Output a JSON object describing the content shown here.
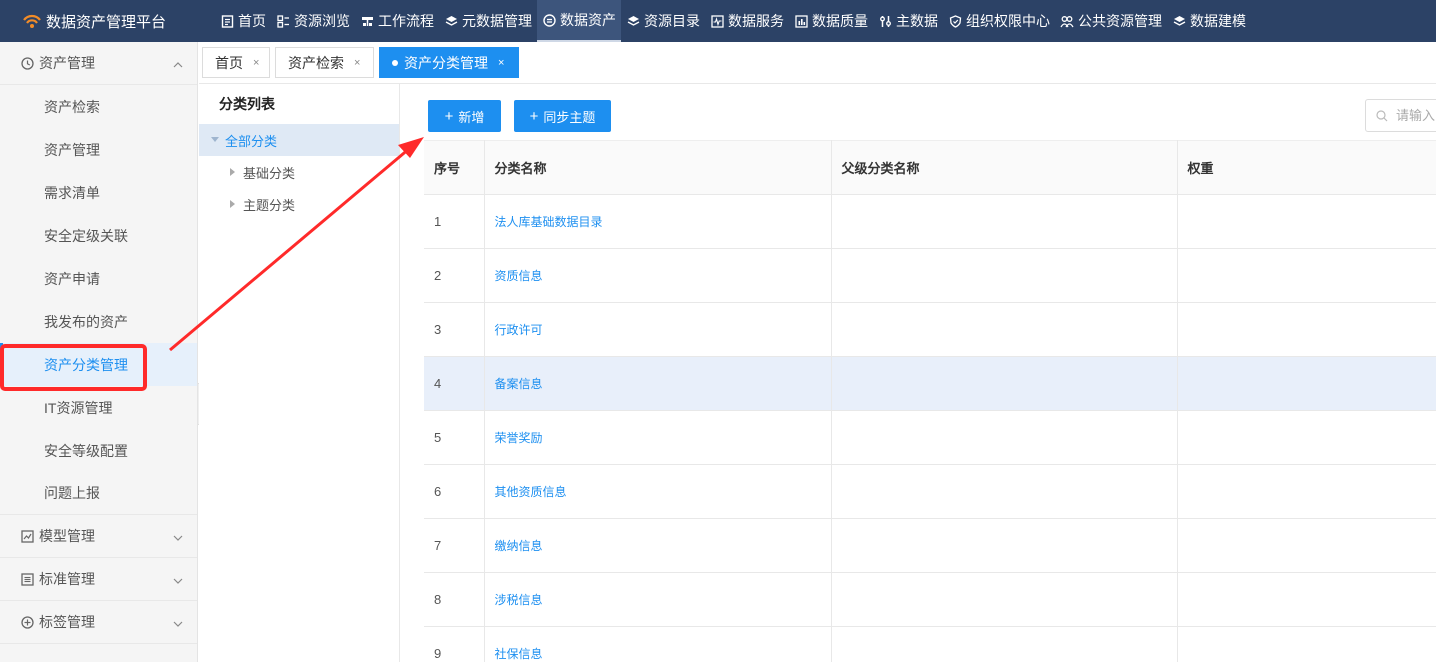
{
  "app": {
    "title": "数据资产管理平台"
  },
  "nav": [
    {
      "label": "首页",
      "icon": "document-icon"
    },
    {
      "label": "资源浏览",
      "icon": "grid-icon"
    },
    {
      "label": "工作流程",
      "icon": "flow-icon"
    },
    {
      "label": "元数据管理",
      "icon": "layers-icon"
    },
    {
      "label": "数据资产",
      "icon": "circle-list-icon",
      "active": true
    },
    {
      "label": "资源目录",
      "icon": "layers-icon"
    },
    {
      "label": "数据服务",
      "icon": "pulse-icon"
    },
    {
      "label": "数据质量",
      "icon": "bar-chart-icon"
    },
    {
      "label": "主数据",
      "icon": "tools-icon"
    },
    {
      "label": "组织权限中心",
      "icon": "shield-icon"
    },
    {
      "label": "公共资源管理",
      "icon": "people-icon"
    },
    {
      "label": "数据建模",
      "icon": "layers-icon"
    }
  ],
  "sidebar": {
    "asset_group": {
      "label": "资产管理"
    },
    "items": [
      {
        "label": "资产检索"
      },
      {
        "label": "资产管理"
      },
      {
        "label": "需求清单"
      },
      {
        "label": "安全定级关联"
      },
      {
        "label": "资产申请"
      },
      {
        "label": "我发布的资产"
      },
      {
        "label": "资产分类管理",
        "active": true
      },
      {
        "label": "IT资源管理"
      },
      {
        "label": "安全等级配置"
      },
      {
        "label": "问题上报"
      }
    ],
    "groups": [
      {
        "label": "模型管理"
      },
      {
        "label": "标准管理"
      },
      {
        "label": "标签管理"
      }
    ]
  },
  "tabs": [
    {
      "label": "首页",
      "close": "×"
    },
    {
      "label": "资产检索",
      "close": "×"
    },
    {
      "label": "资产分类管理",
      "close": "×",
      "active": true
    }
  ],
  "tree": {
    "title": "分类列表",
    "root": "全部分类",
    "children": [
      "基础分类",
      "主题分类"
    ]
  },
  "toolbar": {
    "add_label": "新增",
    "sync_label": "同步主题",
    "search_placeholder": "请输入"
  },
  "table": {
    "columns": [
      "序号",
      "分类名称",
      "父级分类名称",
      "权重"
    ],
    "rows": [
      {
        "index": "1",
        "name": "法人库基础数据目录",
        "parent": "",
        "weight": ""
      },
      {
        "index": "2",
        "name": "资质信息",
        "parent": "",
        "weight": ""
      },
      {
        "index": "3",
        "name": "行政许可",
        "parent": "",
        "weight": ""
      },
      {
        "index": "4",
        "name": "备案信息",
        "parent": "",
        "weight": ""
      },
      {
        "index": "5",
        "name": "荣誉奖励",
        "parent": "",
        "weight": ""
      },
      {
        "index": "6",
        "name": "其他资质信息",
        "parent": "",
        "weight": ""
      },
      {
        "index": "7",
        "name": "缴纳信息",
        "parent": "",
        "weight": ""
      },
      {
        "index": "8",
        "name": "涉税信息",
        "parent": "",
        "weight": ""
      },
      {
        "index": "9",
        "name": "社保信息",
        "parent": "",
        "weight": ""
      }
    ]
  },
  "colors": {
    "topbar": "#2c4266",
    "accent": "#1d8ff0",
    "annotation": "#ff2a2a"
  }
}
